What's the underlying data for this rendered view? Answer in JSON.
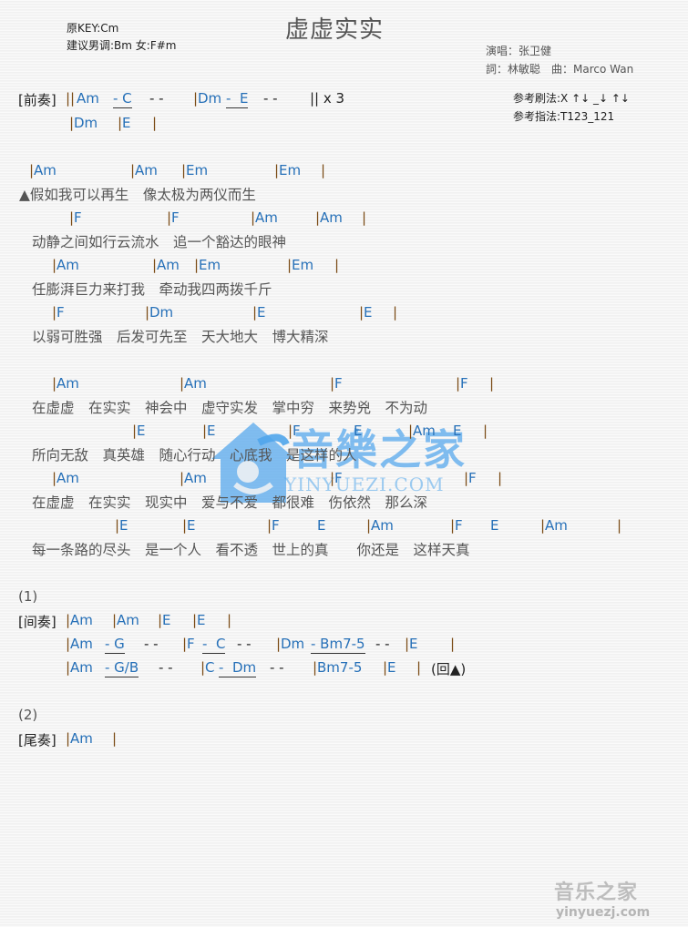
{
  "header": {
    "original_key": "原KEY:Cm",
    "suggested_key": "建议男调:Bm 女:F#m",
    "title": "虚虚实实",
    "singer": "演唱：张卫健",
    "writers": "詞：林敏聪　曲：Marco Wan",
    "strum": "参考刷法:X ↑↓ _↓ ↑↓",
    "fingering": "参考指法:T123_121"
  },
  "intro": {
    "label": "[前奏]",
    "line1": [
      "||",
      "Am",
      "- C",
      "- -",
      "|",
      "Dm",
      "-  E",
      "- -",
      "|| x 3"
    ],
    "line2": [
      "|",
      "Dm",
      "|",
      "E",
      "|"
    ]
  },
  "verse": [
    {
      "chords": [
        "Am",
        "Am",
        "Em",
        "Em"
      ],
      "lyric": "▲假如我可以再生　像太极为两仪而生"
    },
    {
      "chords": [
        "F",
        "F",
        "Am",
        "Am"
      ],
      "lyric": "动静之间如行云流水　追一个豁达的眼神"
    },
    {
      "chords": [
        "Am",
        "Am",
        "Em",
        "Em"
      ],
      "lyric": "任膨湃巨力来打我　牵动我四两拨千斤"
    },
    {
      "chords": [
        "F",
        "Dm",
        "E",
        "E"
      ],
      "lyric": "以弱可胜强　后发可先至　天大地大　博大精深"
    }
  ],
  "chorus": [
    {
      "chords": [
        "Am",
        "Am",
        "F",
        "F"
      ],
      "lyric": "在虚虚　在实实　神会中　虚守实发　掌中穷　来势兇　不为动"
    },
    {
      "chords": [
        "E",
        "E",
        "F",
        "E",
        "Am",
        "E"
      ],
      "lyric": "所向无敌　真英雄　随心行动　心底我　是这样的人"
    },
    {
      "chords": [
        "Am",
        "Am",
        "F",
        "F"
      ],
      "lyric": "在虚虚　在实实　现实中　爱与不爱　都很难　伤依然　那么深"
    },
    {
      "chords": [
        "E",
        "E",
        "F",
        "E",
        "Am",
        "F",
        "E",
        "Am"
      ],
      "lyric": "每一条路的尽头　是一个人　看不透　世上的真　　你还是　这样天真"
    }
  ],
  "interlude": {
    "marker": "(1)",
    "label": "[间奏]",
    "line1": [
      "Am",
      "Am",
      "E",
      "E"
    ],
    "line2": [
      "Am",
      "- G",
      "- -",
      "F",
      "-  C",
      "- -",
      "Dm",
      "- Bm7-5",
      "- -",
      "E"
    ],
    "line3": [
      "Am",
      "- G/B",
      "- -",
      "C",
      "-  Dm",
      "- -",
      "Bm7-5",
      "E",
      "(回▲)"
    ]
  },
  "outro": {
    "marker": "(2)",
    "label": "[尾奏]",
    "chords": [
      "Am"
    ]
  },
  "watermark": {
    "name": "音樂之家",
    "url": "YINYUEZI.COM",
    "corner_name": "音乐之家",
    "corner_url": "yinyuezj.com"
  },
  "colors": {
    "chord": "#2670b8",
    "barline": "#7a4a14",
    "lyric": "#555555"
  }
}
